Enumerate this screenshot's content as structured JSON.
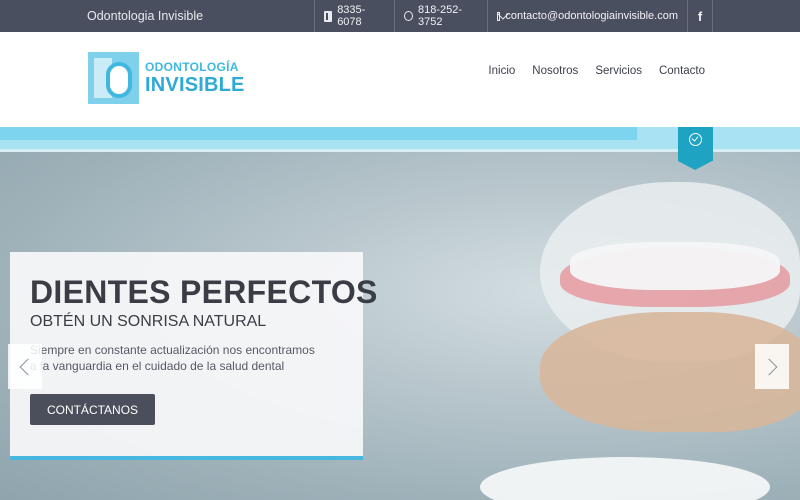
{
  "topbar": {
    "site_name": "Odontologia Invisible",
    "phone1": "8335-6078",
    "phone2": "818-252-3752",
    "email": "contacto@odontologiainvisible.com",
    "facebook": "f"
  },
  "header": {
    "logo_line1": "ODONTOLOGÍA",
    "logo_line2": "INVISIBLE",
    "nav": [
      "Inicio",
      "Nosotros",
      "Servicios",
      "Contacto"
    ]
  },
  "hero": {
    "title": "DIENTES PERFECTOS",
    "subtitle": "OBTÉN UN SONRISA NATURAL",
    "description": "Siempre en constante actualización nos encontramos a la vanguardia en el cuidado de la salud dental",
    "cta": "CONTÁCTANOS"
  },
  "colors": {
    "topbar_bg": "#4a4f5f",
    "accent": "#47b7df",
    "badge": "#1fa3c3",
    "button": "#4b4f5c"
  },
  "icons": [
    "phone-icon",
    "whatsapp-icon",
    "mail-icon",
    "facebook-icon",
    "clock-icon",
    "chevron-left-icon",
    "chevron-right-icon"
  ]
}
